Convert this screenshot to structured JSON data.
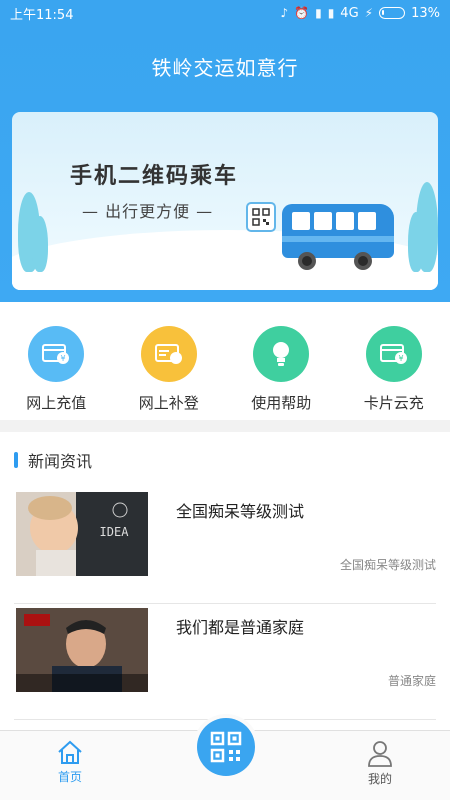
{
  "status_bar": {
    "time": "上午11:54",
    "network": "4G",
    "battery": "13%",
    "battery_level": 0.13
  },
  "header": {
    "title": "铁岭交运如意行"
  },
  "banner": {
    "title": "手机二维码乘车",
    "subtitle": "— 出行更方便 —"
  },
  "functions": [
    {
      "label": "网上充值",
      "color": "#58bbf5",
      "icon": "card-recharge-icon"
    },
    {
      "label": "网上补登",
      "color": "#f8c13b",
      "icon": "card-supplement-icon"
    },
    {
      "label": "使用帮助",
      "color": "#3fcf9f",
      "icon": "lightbulb-icon"
    },
    {
      "label": "卡片云充",
      "color": "#3fcf9f",
      "icon": "card-cloud-icon"
    }
  ],
  "news": {
    "section_title": "新闻资讯",
    "items": [
      {
        "title": "全国痴呆等级测试",
        "subtitle": "全国痴呆等级测试"
      },
      {
        "title": "我们都是普通家庭",
        "subtitle": "普通家庭"
      }
    ]
  },
  "bottom_nav": {
    "home": {
      "label": "首页",
      "color": "#2e9cf0"
    },
    "mine": {
      "label": "我的",
      "color": "#555555"
    },
    "scan_icon": "qr-scan-icon"
  }
}
